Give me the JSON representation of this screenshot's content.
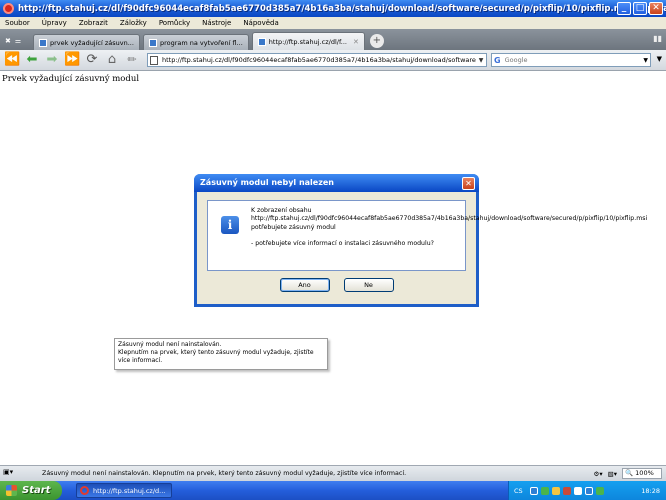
{
  "window": {
    "title": "http://ftp.stahuj.cz/dl/f90dfc96044ecaf8fab5ae6770d385a7/4b16a3ba/stahuj/download/software/secured/p/pixflip/10/pixflip.msi - Opera",
    "buttons": {
      "minimize": "_",
      "maximize": "□",
      "close": "✕"
    }
  },
  "menubar": {
    "items": [
      "Soubor",
      "Úpravy",
      "Zobrazit",
      "Záložky",
      "Pomůcky",
      "Nástroje",
      "Nápověda"
    ]
  },
  "tabs": [
    {
      "label": "prvek vyžadující zásuvn...",
      "active": false
    },
    {
      "label": "program na vytvoření fl...",
      "active": false
    },
    {
      "label": "http://ftp.stahuj.cz/dl/f...",
      "active": true
    }
  ],
  "addressbar": {
    "url": "http://ftp.stahuj.cz/dl/f90dfc96044ecaf8fab5ae6770d385a7/4b16a3ba/stahuj/download/software/secu",
    "search_placeholder": "Google"
  },
  "page": {
    "heading": "Prvek vyžadující zásuvný modul"
  },
  "dialog": {
    "title": "Zásuvný modul nebyl nalezen",
    "message": "K zobrazení obsahu http://ftp.stahuj.cz/dl/f90dfc96044ecaf8fab5ae6770d385a7/4b16a3ba/stahuj/download/software/secured/p/pixflip/10/pixflip.msi potřebujete zásuvný modul",
    "question": "- potřebujete více informací o instalaci zásuvného modulu?",
    "yes_label": "Ano",
    "no_label": "Ne"
  },
  "tooltip": {
    "line1": "Zásuvný modul  není nainstalován.",
    "line2": "Klepnutím na prvek, který tento zásuvný modul vyžaduje, zjistíte",
    "line3": "více  informací."
  },
  "statusbar": {
    "text": "Zásuvný modul  není nainstalován. Klepnutím na prvek, který tento zásuvný modul vyžaduje, zjistíte více  informací.",
    "zoom": "100%"
  },
  "taskbar": {
    "start_label": "Start",
    "task_label": "http://ftp.stahuj.cz/d...",
    "language": "CS",
    "time": "18:28"
  },
  "colors": {
    "titlebar": "#1d5fd6",
    "start_button": "#3b9430",
    "tray": "#0d86dd",
    "dialog_background": "#ece9d8"
  }
}
